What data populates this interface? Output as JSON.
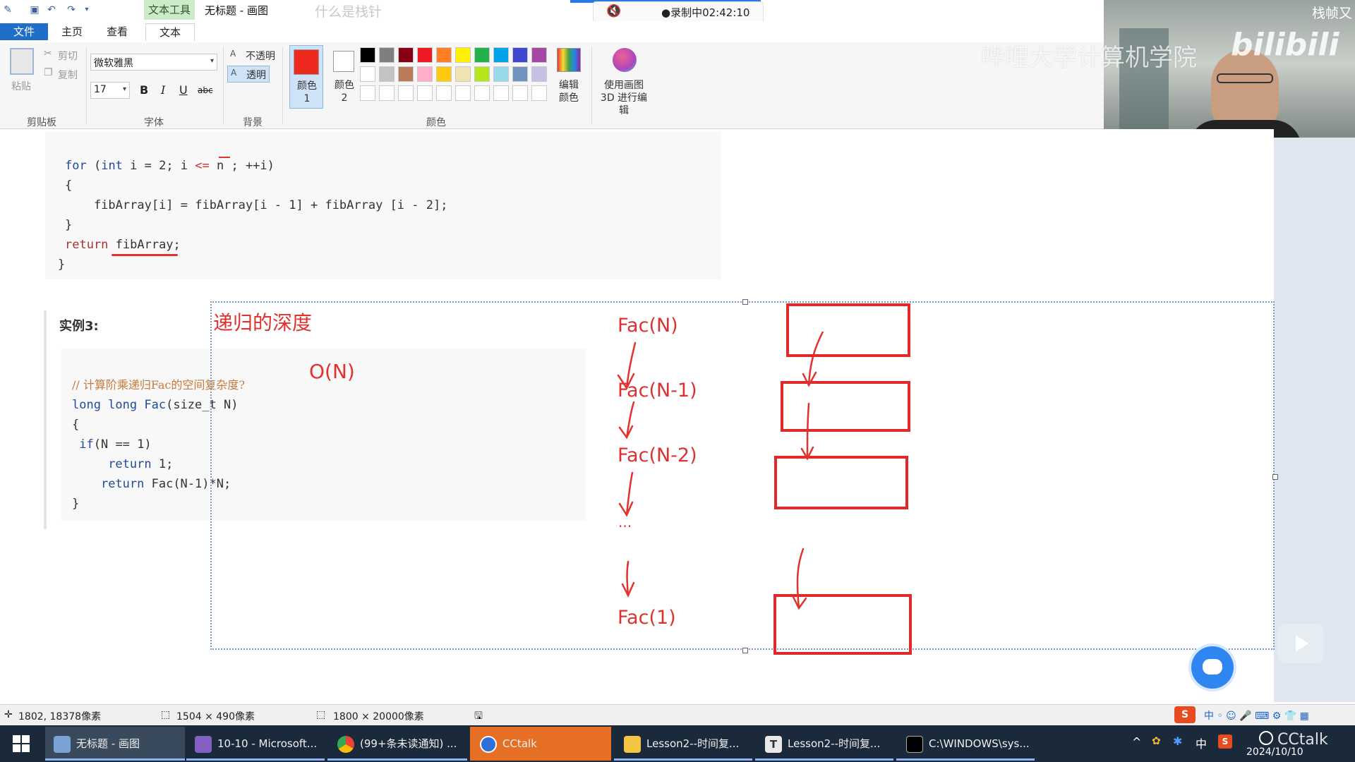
{
  "titlebar": {
    "context_tab": "文本工具",
    "window_title": "无标题 - 画图",
    "overlay_title": "什么是栈针",
    "recording": "●录制中02:42:10",
    "top_right_text": "栈帧又"
  },
  "ribbon_tabs": [
    "文件",
    "主页",
    "查看",
    "文本"
  ],
  "ribbon": {
    "clipboard": {
      "paste": "粘贴",
      "cut": "剪切",
      "copy": "复制",
      "group": "剪贴板"
    },
    "font": {
      "family": "微软雅黑",
      "size": "17",
      "bold": "B",
      "italic": "I",
      "underline": "U",
      "strike": "abc",
      "group": "字体"
    },
    "background": {
      "opaque": "不透明",
      "transparent": "透明",
      "group": "背景"
    },
    "colors": {
      "color1_label": "颜色 1",
      "color2_label": "颜色 2",
      "edit_label": "编辑颜色",
      "paint3d_label": "使用画图 3D 进行编辑",
      "group": "颜色",
      "color1": "#ee2a1f",
      "color2": "#ffffff",
      "palette_row1": [
        "#000000",
        "#7f7f7f",
        "#880015",
        "#ed1c24",
        "#ff7f27",
        "#fff200",
        "#22b14c",
        "#00a2e8",
        "#3f48cc",
        "#a349a4"
      ],
      "palette_row2": [
        "#ffffff",
        "#c3c3c3",
        "#b97a57",
        "#ffaec9",
        "#ffc90e",
        "#efe4b0",
        "#b5e61d",
        "#99d9ea",
        "#7092be",
        "#c8bfe7"
      ]
    }
  },
  "watermark": {
    "text": "哔哩大学计算机学院",
    "logo": "bilibili"
  },
  "code_top": {
    "lines": [
      "for (int i = 2; i <= n ; ++i)",
      "{",
      "    fibArray[i] = fibArray[i - 1] + fibArray [i - 2];",
      "}",
      "",
      "return fibArray;",
      "}"
    ]
  },
  "example3": {
    "heading": "实例3:",
    "lines": [
      "// 计算阶乘递归Fac的空间复杂度?",
      "long long Fac(size_t N)",
      "{",
      " if(N == 1)",
      "     return 1;",
      "",
      "    return Fac(N-1)*N;",
      "}"
    ]
  },
  "annotations": {
    "recursion_depth": "递归的深度",
    "complexity": "O(N)",
    "fac_n": "Fac(N)",
    "fac_n1": "Fac(N-1)",
    "fac_n2": "Fac(N-2)",
    "ellipsis": "...",
    "fac_1": "Fac(1)"
  },
  "statusbar": {
    "cursor_pos": "1802, 18378像素",
    "selection_size": "1504 × 490像素",
    "image_size": "1800 × 20000像素"
  },
  "taskbar": {
    "items": [
      "无标题 - 画图",
      "10-10 - Microsoft...",
      "(99+条未读通知) ...",
      "CCtalk",
      "Lesson2--时间复...",
      "Lesson2--时间复...",
      "C:\\WINDOWS\\sys..."
    ],
    "clock_date": "2024/10/10",
    "tray_ime": "中",
    "cctalk_brand": "CCtalk"
  }
}
